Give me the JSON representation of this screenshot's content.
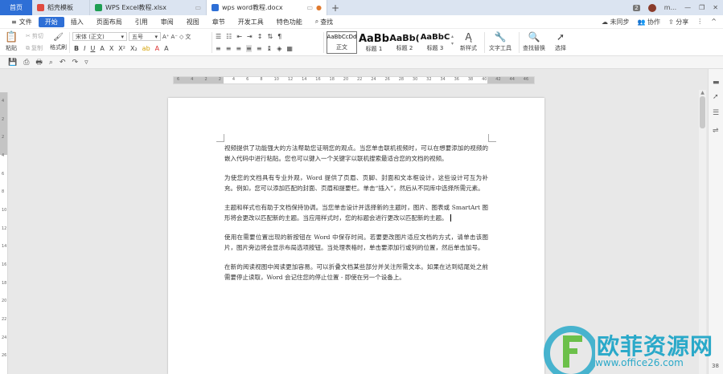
{
  "tabs": {
    "home": "首页",
    "items": [
      {
        "label": "稻壳模板",
        "icon_color": "#e04a3f"
      },
      {
        "label": "WPS Excel教程.xlsx",
        "icon_color": "#1e9e52"
      },
      {
        "label": "wps word教程.docx",
        "icon_color": "#2e6fd6"
      }
    ],
    "add": "+",
    "count_badge": "2",
    "user": "m..."
  },
  "menu": {
    "file": "文件",
    "items": [
      "开始",
      "插入",
      "页面布局",
      "引用",
      "审阅",
      "视图",
      "章节",
      "开发工具",
      "特色功能"
    ],
    "search": "查找",
    "right": [
      "未同步",
      "协作",
      "分享"
    ]
  },
  "ribbon": {
    "paste": "粘贴",
    "cut": "剪切",
    "copy": "复制",
    "format_painter": "格式刷",
    "font_name": "宋体 (正文)",
    "font_size": "五号",
    "styles": [
      {
        "sample": "AaBbCcDd",
        "label": "正文"
      },
      {
        "sample": "AaBb",
        "label": "标题 1"
      },
      {
        "sample": "AaBb(",
        "label": "标题 2"
      },
      {
        "sample": "AaBbC",
        "label": "标题 3"
      }
    ],
    "new_style": "新样式",
    "text_tools": "文字工具",
    "find_replace": "查找替换",
    "select": "选择"
  },
  "ruler": {
    "ticks": [
      "6",
      "4",
      "2",
      "2",
      "4",
      "6",
      "8",
      "10",
      "12",
      "14",
      "16",
      "18",
      "20",
      "22",
      "24",
      "26",
      "28",
      "30",
      "32",
      "34",
      "36",
      "38",
      "40",
      "42",
      "44",
      "46"
    ],
    "vticks": [
      "4",
      "2",
      "2",
      "4",
      "6",
      "8",
      "10",
      "12",
      "14",
      "16",
      "18",
      "20",
      "22",
      "24",
      "26"
    ]
  },
  "document": {
    "paragraphs": [
      "视频提供了功能强大的方法帮助您证明您的观点。当您单击联机视频时，可以在想要添加的视频的嵌入代码中进行粘贴。您也可以键入一个关键字以联机搜索最适合您的文档的视频。",
      "为使您的文档具有专业外观，Word 提供了页眉、页脚、封面和文本框设计，这些设计可互为补充。例如，您可以添加匹配的封面、页眉和提要栏。单击“插入”，然后从不同库中选择所需元素。",
      "主题和样式也有助于文档保持协调。当您单击设计并选择新的主题时，图片、图表或 SmartArt 图形将会更改以匹配新的主题。当应用样式时，您的标题会进行更改以匹配新的主题。",
      "使用在需要位置出现的新按钮在 Word 中保存时间。若要更改图片适应文档的方式，请单击该图片，图片旁边将会显示布局选项按钮。当处理表格时，单击要添加行或列的位置，然后单击加号。",
      "在新的阅读视图中阅读更加容易。可以折叠文档某些部分并关注所需文本。如果在达到结尾处之前需要停止读取，Word 会记住您的停止位置 - 即使在另一个设备上。"
    ]
  },
  "watermark": {
    "text": "欧菲资源网",
    "url": "www.office26.com"
  },
  "status": {
    "page_hint": "38"
  }
}
